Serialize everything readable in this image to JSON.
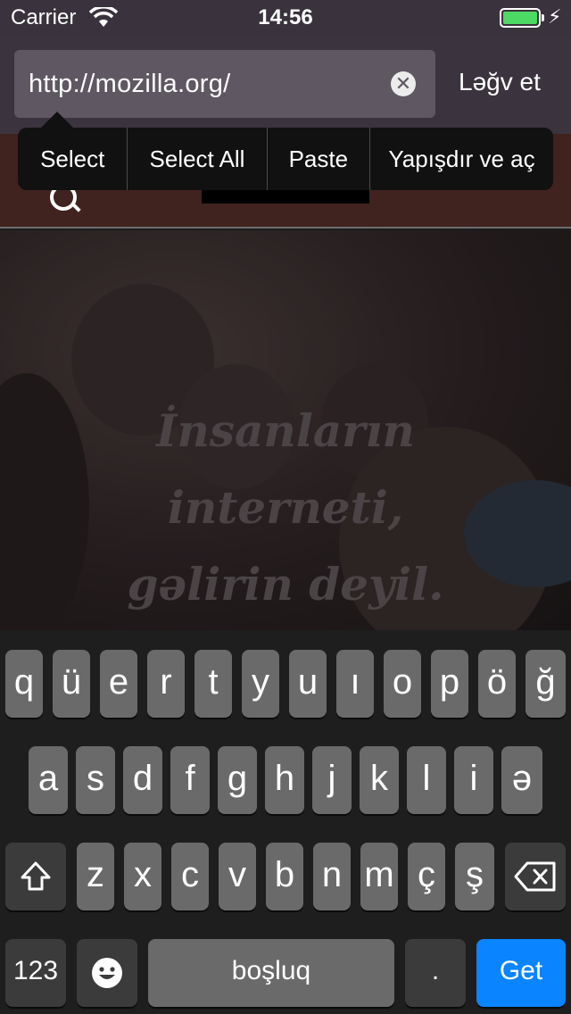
{
  "status_bar": {
    "carrier": "Carrier",
    "time": "14:56"
  },
  "url_bar": {
    "url": "http://mozilla.org/",
    "cancel_label": "Ləğv et"
  },
  "edit_menu": {
    "items": [
      "Select",
      "Select All",
      "Paste",
      "Yapışdır ve aç"
    ]
  },
  "hero": {
    "lines": [
      "İnsanların",
      "interneti,",
      "gəlirin deyil."
    ]
  },
  "keyboard": {
    "row1": [
      "q",
      "ü",
      "e",
      "r",
      "t",
      "y",
      "u",
      "ı",
      "o",
      "p",
      "ö",
      "ğ"
    ],
    "row2": [
      "a",
      "s",
      "d",
      "f",
      "g",
      "h",
      "j",
      "k",
      "l",
      "i",
      "ə"
    ],
    "row3": [
      "z",
      "x",
      "c",
      "v",
      "b",
      "n",
      "m",
      "ç",
      "ş"
    ],
    "numbers_label": "123",
    "space_label": "boşluq",
    "period_label": ".",
    "go_label": "Get"
  },
  "colors": {
    "battery": "#4cd964",
    "go_key": "#0a84ff"
  }
}
